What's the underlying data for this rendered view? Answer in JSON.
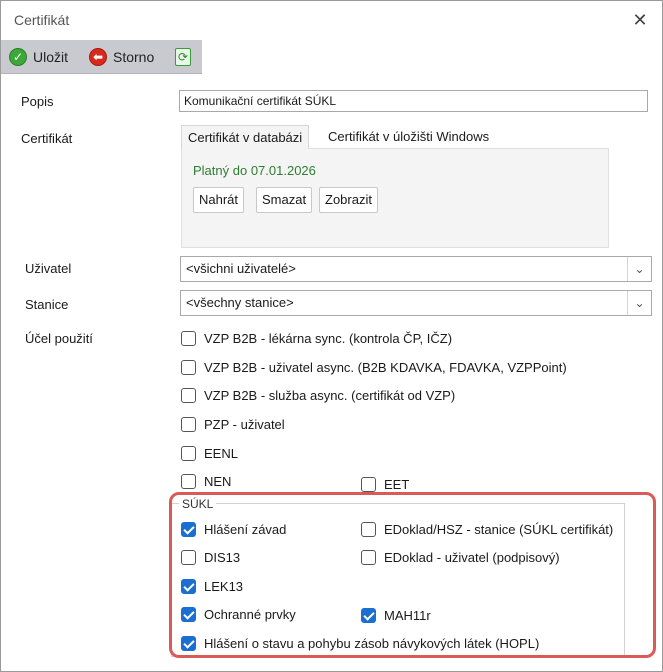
{
  "window": {
    "title": "Certifikát",
    "close_glyph": "✕"
  },
  "toolbar": {
    "save_label": "Uložit",
    "cancel_label": "Storno",
    "icons": {
      "save": "check-circle-icon",
      "cancel": "back-arrow-circle-icon",
      "refresh": "refresh-icon"
    }
  },
  "form": {
    "popis_label": "Popis",
    "popis_value": "Komunikační certifikát SÚKL",
    "certifikat_label": "Certifikát",
    "tabs": [
      {
        "label": "Certifikát v databázi",
        "active": true
      },
      {
        "label": "Certifikát v úložišti Windows",
        "active": false
      }
    ],
    "valid_until": "Platný do 07.01.2026",
    "buttons": {
      "upload": "Nahrát",
      "delete": "Smazat",
      "show": "Zobrazit"
    },
    "uzivatel_label": "Uživatel",
    "uzivatel_value": "<všichni uživatelé>",
    "stanice_label": "Stanice",
    "stanice_value": "<všechny stanice>",
    "ucel_label": "Účel použití"
  },
  "purposes": [
    {
      "label": "VZP B2B - lékárna sync. (kontrola ČP, IČZ)",
      "checked": false
    },
    {
      "label": "VZP B2B - uživatel async. (B2B KDAVKA, FDAVKA, VZPPoint)",
      "checked": false
    },
    {
      "label": "VZP B2B - služba async. (certifikát od VZP)",
      "checked": false
    },
    {
      "label": "PZP - uživatel",
      "checked": false
    },
    {
      "label": "EENL",
      "checked": false
    },
    {
      "label": "NEN",
      "checked": false
    },
    {
      "label": "EET",
      "checked": false
    }
  ],
  "sukl": {
    "title": "SÚKL",
    "items": [
      {
        "label": "Hlášení závad",
        "checked": true
      },
      {
        "label": "EDoklad/HSZ - stanice (SÚKL certifikát)",
        "checked": false
      },
      {
        "label": "DIS13",
        "checked": false
      },
      {
        "label": "EDoklad - uživatel (podpisový)",
        "checked": false
      },
      {
        "label": "LEK13",
        "checked": true
      },
      {
        "label": "Ochranné prvky",
        "checked": true
      },
      {
        "label": "MAH11r",
        "checked": true
      },
      {
        "label": "Hlášení o stavu a pohybu zásob návykových látek (HOPL)",
        "checked": true
      }
    ]
  },
  "colors": {
    "accent": "#1a6fd0",
    "valid_green": "#2e7d32",
    "highlight": "#d95a57",
    "toolbar_bg": "#c9cad0"
  }
}
